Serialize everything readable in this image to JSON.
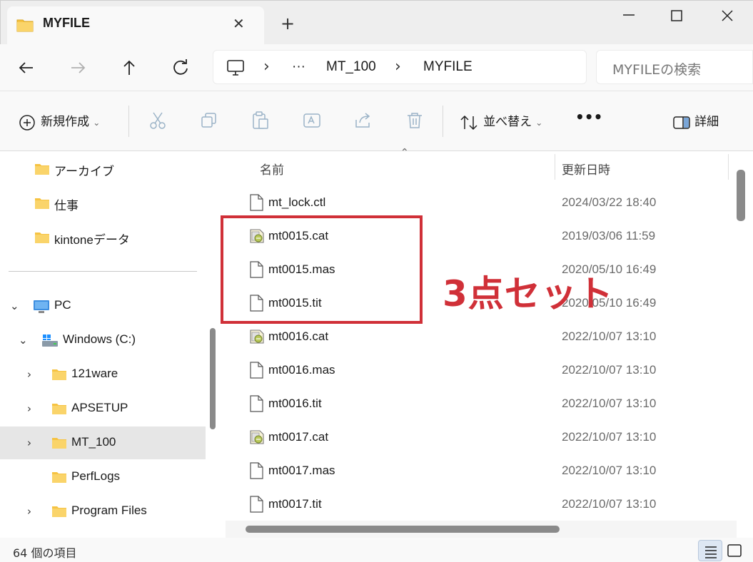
{
  "window": {
    "tab_title": "MYFILE",
    "tab_icon": "folder-icon",
    "accent_folder": "#F6C342"
  },
  "nav": {
    "breadcrumbs": [
      "MT_100",
      "MYFILE"
    ],
    "overflow": "···",
    "search_placeholder": "MYFILEの検索"
  },
  "toolbar": {
    "new_label": "新規作成",
    "sort_label": "並べ替え",
    "details_label": "詳細",
    "more": "•••"
  },
  "sidebar": {
    "items": [
      {
        "label": "アーカイブ",
        "icon": "folder-icon"
      },
      {
        "label": "仕事",
        "icon": "folder-icon"
      },
      {
        "label": "kintoneデータ",
        "icon": "folder-icon"
      },
      {
        "label": "PC",
        "icon": "pc-icon"
      },
      {
        "label": "Windows (C:)",
        "icon": "drive-icon"
      },
      {
        "label": "121ware",
        "icon": "folder-icon"
      },
      {
        "label": "APSETUP",
        "icon": "folder-icon"
      },
      {
        "label": "MT_100",
        "icon": "folder-icon",
        "selected": true
      },
      {
        "label": "PerfLogs",
        "icon": "folder-icon"
      },
      {
        "label": "Program Files",
        "icon": "folder-icon"
      }
    ]
  },
  "file_list": {
    "columns": [
      "名前",
      "更新日時"
    ],
    "rows": [
      {
        "name": "mt_lock.ctl",
        "date": "2024/03/22 18:40",
        "icon": "file-icon"
      },
      {
        "name": "mt0015.cat",
        "date": "2019/03/06 11:59",
        "icon": "catalog-file-icon"
      },
      {
        "name": "mt0015.mas",
        "date": "2020/05/10 16:49",
        "icon": "file-icon"
      },
      {
        "name": "mt0015.tit",
        "date": "2020/05/10 16:49",
        "icon": "file-icon"
      },
      {
        "name": "mt0016.cat",
        "date": "2022/10/07 13:10",
        "icon": "catalog-file-icon"
      },
      {
        "name": "mt0016.mas",
        "date": "2022/10/07 13:10",
        "icon": "file-icon"
      },
      {
        "name": "mt0016.tit",
        "date": "2022/10/07 13:10",
        "icon": "file-icon"
      },
      {
        "name": "mt0017.cat",
        "date": "2022/10/07 13:10",
        "icon": "catalog-file-icon"
      },
      {
        "name": "mt0017.mas",
        "date": "2022/10/07 13:10",
        "icon": "file-icon"
      },
      {
        "name": "mt0017.tit",
        "date": "2022/10/07 13:10",
        "icon": "file-icon"
      }
    ]
  },
  "annotation": {
    "text": "3点セット",
    "color": "#D03038"
  },
  "status": {
    "item_count": "64 個の項目"
  }
}
